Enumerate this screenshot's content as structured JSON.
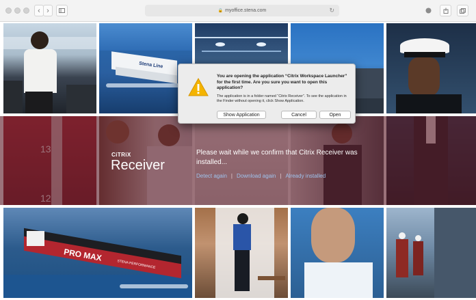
{
  "browser": {
    "url": "myoffice.stena.com"
  },
  "background": {
    "top_ship_name": "Stena Line",
    "tanker_text_1": "PRO MAX",
    "tanker_text_2": "STENA PERFORMANCE",
    "deck_numbers_upper": "13",
    "deck_numbers_lower": "12"
  },
  "citrix": {
    "brand": "CiTRiX",
    "product": "Receiver",
    "message": "Please wait while we confirm that Citrix Receiver was installed...",
    "links": [
      "Detect again",
      "Download again",
      "Already installed"
    ]
  },
  "dialog": {
    "title": "You are opening the application “Citrix Workspace Launcher” for the first time. Are you sure you want to open this application?",
    "message": "The application is in a folder named “Citrix Receiver”. To see the application in the Finder without opening it, click Show Application.",
    "buttons": {
      "show": "Show Application",
      "cancel": "Cancel",
      "open": "Open"
    }
  }
}
